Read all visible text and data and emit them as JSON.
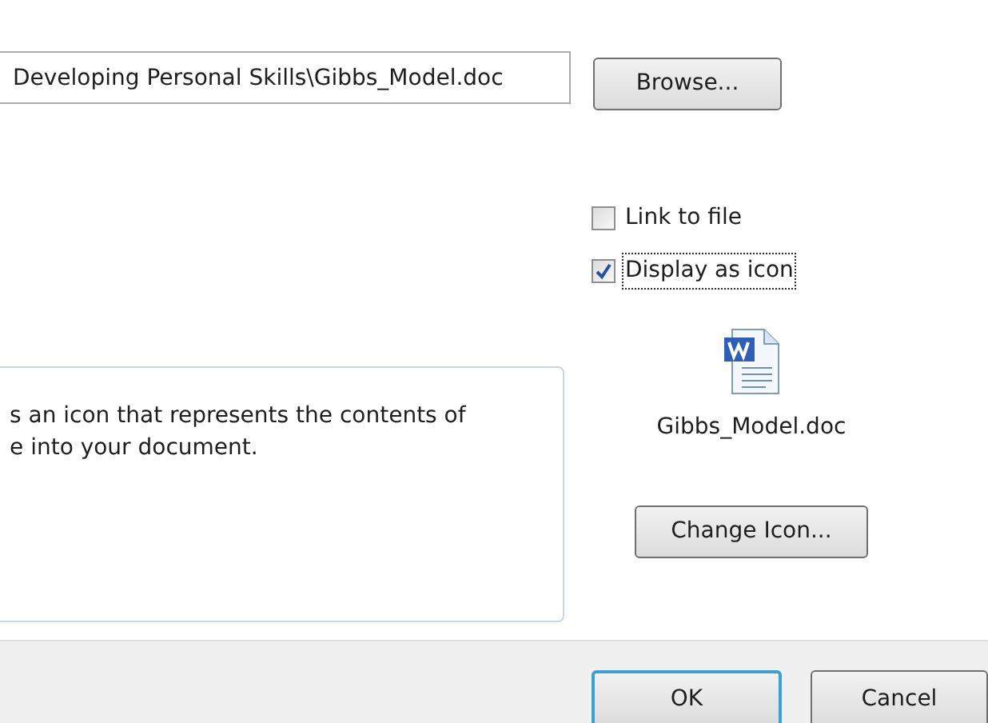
{
  "file_path": {
    "value": "Developing Personal Skills\\Gibbs_Model.doc"
  },
  "browse_button": "Browse...",
  "options": [
    {
      "label": "Link to file",
      "checked": false,
      "focused": false
    },
    {
      "label": "Display as icon",
      "checked": true,
      "focused": true
    }
  ],
  "result": {
    "lines": [
      "s an icon that represents the contents of",
      "e into your document."
    ]
  },
  "icon_caption": "Gibbs_Model.doc",
  "change_icon_button": "Change Icon...",
  "buttons": [
    {
      "label": "OK",
      "default": true
    },
    {
      "label": "Cancel",
      "default": false
    }
  ]
}
